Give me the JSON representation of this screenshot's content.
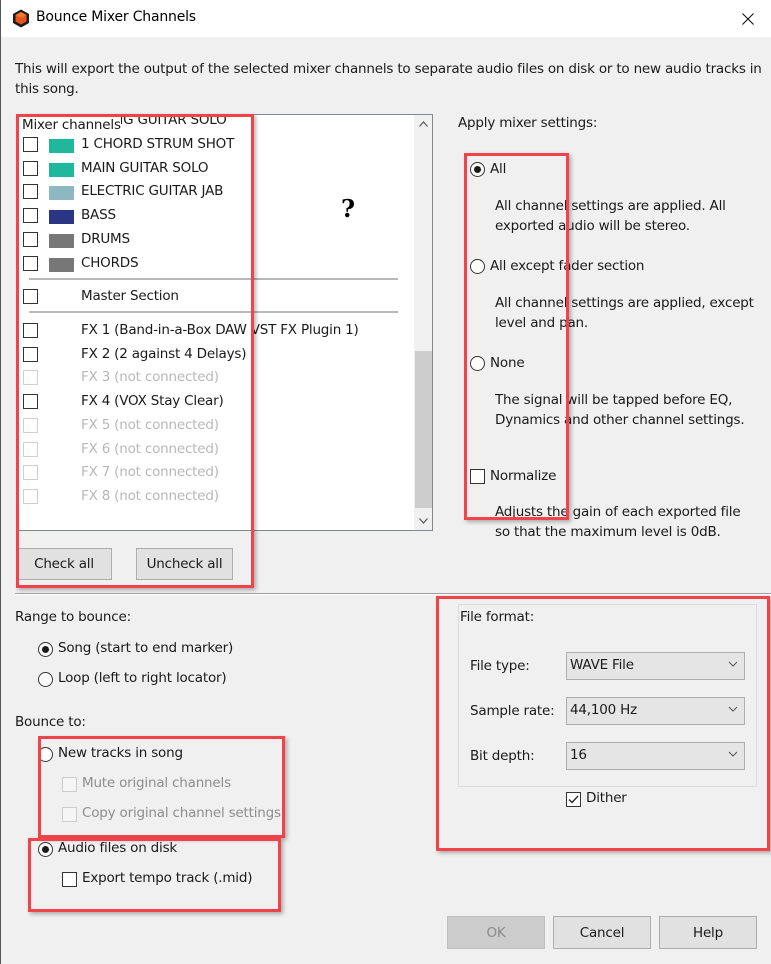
{
  "window": {
    "title": "Bounce Mixer Channels",
    "app_icon": "cube-icon",
    "close_icon": "close-icon"
  },
  "intro_text": "This will export the output of the selected mixer channels to separate audio files on disk or to new audio tracks in this song.",
  "mixer_channels": {
    "caption": "Mixer channels",
    "channels": [
      {
        "label": "ENDING GUITAR SOLO",
        "color": "#1fb89d",
        "checked": false,
        "enabled": true
      },
      {
        "label": "1 CHORD STRUM SHOT",
        "color": "#1fb89d",
        "checked": false,
        "enabled": true
      },
      {
        "label": "MAIN GUITAR SOLO",
        "color": "#1fb89d",
        "checked": false,
        "enabled": true
      },
      {
        "label": "ELECTRIC GUITAR JAB",
        "color": "#8db8c2",
        "checked": false,
        "enabled": true
      },
      {
        "label": "BASS",
        "color": "#2a3583",
        "checked": false,
        "enabled": true
      },
      {
        "label": "DRUMS",
        "color": "#777777",
        "checked": false,
        "enabled": true
      },
      {
        "label": "CHORDS",
        "color": "#777777",
        "checked": false,
        "enabled": true
      }
    ],
    "master": {
      "label": "Master Section",
      "checked": false,
      "enabled": true
    },
    "fx": [
      {
        "label": "FX 1 (Band-in-a-Box DAW VST FX Plugin 1)",
        "checked": false,
        "enabled": true
      },
      {
        "label": "FX 2 (2 against 4 Delays)",
        "checked": false,
        "enabled": true
      },
      {
        "label": "FX 3 (not connected)",
        "checked": false,
        "enabled": false
      },
      {
        "label": "FX 4 (VOX Stay Clear)",
        "checked": false,
        "enabled": true
      },
      {
        "label": "FX 5 (not connected)",
        "checked": false,
        "enabled": false
      },
      {
        "label": "FX 6 (not connected)",
        "checked": false,
        "enabled": false
      },
      {
        "label": "FX 7 (not connected)",
        "checked": false,
        "enabled": false
      },
      {
        "label": "FX 8 (not connected)",
        "checked": false,
        "enabled": false
      }
    ],
    "check_all_label": "Check all",
    "uncheck_all_label": "Uncheck all",
    "annotation_mark": "?"
  },
  "apply_mixer_settings": {
    "heading": "Apply mixer settings:",
    "selected": "All",
    "options": [
      {
        "label": "All",
        "description": "All channel settings are applied. All exported audio will be stereo.",
        "checked": true
      },
      {
        "label": "All except fader section",
        "description": "All channel settings are applied, except level and pan.",
        "checked": false
      },
      {
        "label": "None",
        "description": "The signal will be tapped before EQ, Dynamics and other channel settings.",
        "checked": false
      }
    ],
    "normalize": {
      "label": "Normalize",
      "description": "Adjusts the gain of each exported file so that the maximum level is 0dB.",
      "checked": false
    }
  },
  "range_to_bounce": {
    "heading": "Range to bounce:",
    "options": [
      {
        "label": "Song (start to end marker)",
        "checked": true
      },
      {
        "label": "Loop (left to right locator)",
        "checked": false
      }
    ]
  },
  "bounce_to": {
    "heading": "Bounce to:",
    "new_tracks": {
      "label": "New tracks in song",
      "checked": false
    },
    "mute_original": {
      "label": "Mute original channels",
      "checked": false,
      "enabled": false
    },
    "copy_settings": {
      "label": "Copy original channel settings",
      "checked": false,
      "enabled": false
    },
    "audio_files": {
      "label": "Audio files on disk",
      "checked": true
    },
    "export_tempo": {
      "label": "Export tempo track (.mid)",
      "checked": false,
      "enabled": true
    }
  },
  "file_format": {
    "heading": "File format:",
    "file_type": {
      "label": "File type:",
      "value": "WAVE File"
    },
    "sample_rate": {
      "label": "Sample rate:",
      "value": "44,100 Hz"
    },
    "bit_depth": {
      "label": "Bit depth:",
      "value": "16"
    },
    "dither": {
      "label": "Dither",
      "checked": true
    }
  },
  "footer": {
    "ok_label": "OK",
    "ok_enabled": false,
    "cancel_label": "Cancel",
    "help_label": "Help"
  },
  "annotation_color": "#f0444a"
}
